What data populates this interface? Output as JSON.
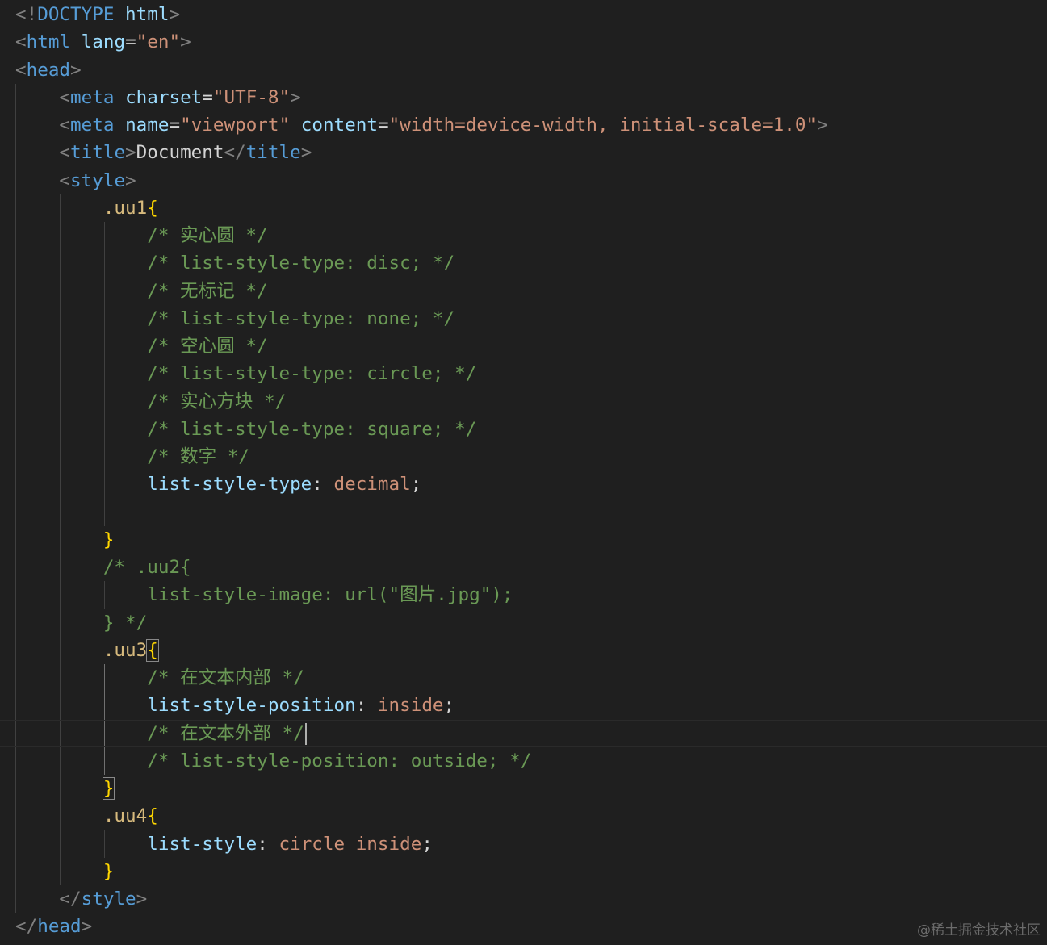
{
  "colors": {
    "background": "#1f1f1f",
    "punctuation": "#808080",
    "tag": "#569cd6",
    "attribute": "#9cdcfe",
    "string": "#ce9178",
    "selector": "#d7ba7d",
    "brace": "#ffd700",
    "property": "#9cdcfe",
    "value": "#ce9178",
    "comment": "#6a9955",
    "text": "#d4d4d4"
  },
  "lines": [
    [
      {
        "t": "<!",
        "k": "punct"
      },
      {
        "t": "DOCTYPE",
        "k": "tag"
      },
      {
        "t": " ",
        "k": "text"
      },
      {
        "t": "html",
        "k": "attr"
      },
      {
        "t": ">",
        "k": "punct"
      }
    ],
    [
      {
        "t": "<",
        "k": "punct"
      },
      {
        "t": "html",
        "k": "tag"
      },
      {
        "t": " ",
        "k": "text"
      },
      {
        "t": "lang",
        "k": "attr"
      },
      {
        "t": "=",
        "k": "text"
      },
      {
        "t": "\"en\"",
        "k": "str"
      },
      {
        "t": ">",
        "k": "punct"
      }
    ],
    [
      {
        "t": "<",
        "k": "punct"
      },
      {
        "t": "head",
        "k": "tag"
      },
      {
        "t": ">",
        "k": "punct"
      }
    ],
    [
      {
        "t": "    ",
        "k": "text"
      },
      {
        "t": "<",
        "k": "punct"
      },
      {
        "t": "meta",
        "k": "tag"
      },
      {
        "t": " ",
        "k": "text"
      },
      {
        "t": "charset",
        "k": "attr"
      },
      {
        "t": "=",
        "k": "text"
      },
      {
        "t": "\"UTF-8\"",
        "k": "str"
      },
      {
        "t": ">",
        "k": "punct"
      }
    ],
    [
      {
        "t": "    ",
        "k": "text"
      },
      {
        "t": "<",
        "k": "punct"
      },
      {
        "t": "meta",
        "k": "tag"
      },
      {
        "t": " ",
        "k": "text"
      },
      {
        "t": "name",
        "k": "attr"
      },
      {
        "t": "=",
        "k": "text"
      },
      {
        "t": "\"viewport\"",
        "k": "str"
      },
      {
        "t": " ",
        "k": "text"
      },
      {
        "t": "content",
        "k": "attr"
      },
      {
        "t": "=",
        "k": "text"
      },
      {
        "t": "\"width=device-width, initial-scale=1.0\"",
        "k": "str"
      },
      {
        "t": ">",
        "k": "punct"
      }
    ],
    [
      {
        "t": "    ",
        "k": "text"
      },
      {
        "t": "<",
        "k": "punct"
      },
      {
        "t": "title",
        "k": "tag"
      },
      {
        "t": ">",
        "k": "punct"
      },
      {
        "t": "Document",
        "k": "text"
      },
      {
        "t": "</",
        "k": "punct"
      },
      {
        "t": "title",
        "k": "tag"
      },
      {
        "t": ">",
        "k": "punct"
      }
    ],
    [
      {
        "t": "    ",
        "k": "text"
      },
      {
        "t": "<",
        "k": "punct"
      },
      {
        "t": "style",
        "k": "tag"
      },
      {
        "t": ">",
        "k": "punct"
      }
    ],
    [
      {
        "t": "        ",
        "k": "text"
      },
      {
        "t": ".uu1",
        "k": "sel"
      },
      {
        "t": "{",
        "k": "brace"
      }
    ],
    [
      {
        "t": "            ",
        "k": "text"
      },
      {
        "t": "/* 实心圆 */",
        "k": "comment"
      }
    ],
    [
      {
        "t": "            ",
        "k": "text"
      },
      {
        "t": "/* list-style-type: disc; */",
        "k": "comment"
      }
    ],
    [
      {
        "t": "            ",
        "k": "text"
      },
      {
        "t": "/* 无标记 */",
        "k": "comment"
      }
    ],
    [
      {
        "t": "            ",
        "k": "text"
      },
      {
        "t": "/* list-style-type: none; */",
        "k": "comment"
      }
    ],
    [
      {
        "t": "            ",
        "k": "text"
      },
      {
        "t": "/* 空心圆 */",
        "k": "comment"
      }
    ],
    [
      {
        "t": "            ",
        "k": "text"
      },
      {
        "t": "/* list-style-type: circle; */",
        "k": "comment"
      }
    ],
    [
      {
        "t": "            ",
        "k": "text"
      },
      {
        "t": "/* 实心方块 */",
        "k": "comment"
      }
    ],
    [
      {
        "t": "            ",
        "k": "text"
      },
      {
        "t": "/* list-style-type: square; */",
        "k": "comment"
      }
    ],
    [
      {
        "t": "            ",
        "k": "text"
      },
      {
        "t": "/* 数字 */",
        "k": "comment"
      }
    ],
    [
      {
        "t": "            ",
        "k": "text"
      },
      {
        "t": "list-style-type",
        "k": "prop"
      },
      {
        "t": ": ",
        "k": "text"
      },
      {
        "t": "decimal",
        "k": "val"
      },
      {
        "t": ";",
        "k": "text"
      }
    ],
    [],
    [
      {
        "t": "        ",
        "k": "text"
      },
      {
        "t": "}",
        "k": "brace"
      }
    ],
    [
      {
        "t": "        ",
        "k": "text"
      },
      {
        "t": "/* .uu2{",
        "k": "comment"
      }
    ],
    [
      {
        "t": "            ",
        "k": "text"
      },
      {
        "t": "list-style-image: url(\"图片.jpg\");",
        "k": "comment"
      }
    ],
    [
      {
        "t": "        ",
        "k": "text"
      },
      {
        "t": "} */",
        "k": "comment"
      }
    ],
    [
      {
        "t": "        ",
        "k": "text"
      },
      {
        "t": ".uu3",
        "k": "sel"
      },
      {
        "t": "{",
        "k": "brace",
        "m": 1
      }
    ],
    [
      {
        "t": "            ",
        "k": "text"
      },
      {
        "t": "/* 在文本内部 */",
        "k": "comment"
      }
    ],
    [
      {
        "t": "            ",
        "k": "text"
      },
      {
        "t": "list-style-position",
        "k": "prop"
      },
      {
        "t": ": ",
        "k": "text"
      },
      {
        "t": "inside",
        "k": "val"
      },
      {
        "t": ";",
        "k": "text"
      }
    ],
    [
      {
        "t": "            ",
        "k": "text"
      },
      {
        "t": "/* 在文本外部 */",
        "k": "comment"
      }
    ],
    [
      {
        "t": "            ",
        "k": "text"
      },
      {
        "t": "/* list-style-position: outside; */",
        "k": "comment"
      }
    ],
    [
      {
        "t": "        ",
        "k": "text"
      },
      {
        "t": "}",
        "k": "brace",
        "m": 1
      }
    ],
    [
      {
        "t": "        ",
        "k": "text"
      },
      {
        "t": ".uu4",
        "k": "sel"
      },
      {
        "t": "{",
        "k": "brace"
      }
    ],
    [
      {
        "t": "            ",
        "k": "text"
      },
      {
        "t": "list-style",
        "k": "prop"
      },
      {
        "t": ": ",
        "k": "text"
      },
      {
        "t": "circle inside",
        "k": "val"
      },
      {
        "t": ";",
        "k": "text"
      }
    ],
    [
      {
        "t": "        ",
        "k": "text"
      },
      {
        "t": "}",
        "k": "brace"
      }
    ],
    [
      {
        "t": "    ",
        "k": "text"
      },
      {
        "t": "</",
        "k": "punct"
      },
      {
        "t": "style",
        "k": "tag"
      },
      {
        "t": ">",
        "k": "punct"
      }
    ],
    [
      {
        "t": "</",
        "k": "punct"
      },
      {
        "t": "head",
        "k": "tag"
      },
      {
        "t": ">",
        "k": "punct"
      }
    ]
  ],
  "cursor_line": 26,
  "watermark": "@稀土掘金技术社区"
}
